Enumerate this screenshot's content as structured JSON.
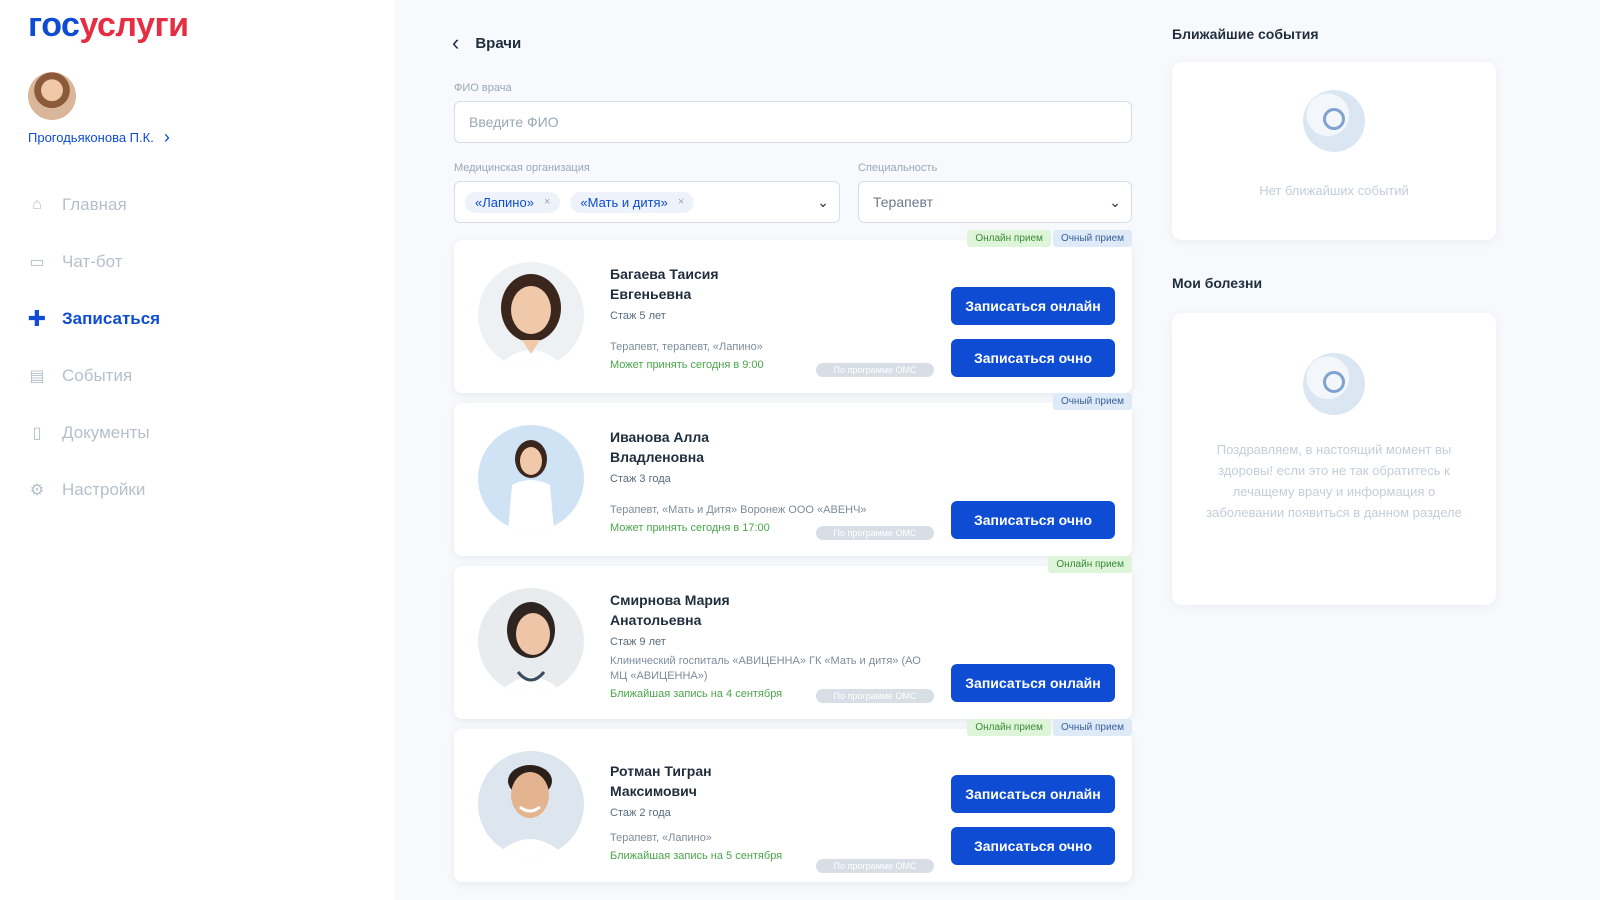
{
  "logo": {
    "part1": "гос",
    "part2": "услуги"
  },
  "user": {
    "name": "Прогодьяконова П.К."
  },
  "nav": [
    {
      "icon": "home-icon",
      "label": "Главная",
      "active": false
    },
    {
      "icon": "chat-icon",
      "label": "Чат-бот",
      "active": false
    },
    {
      "icon": "plus-icon",
      "label": "Записаться",
      "active": true
    },
    {
      "icon": "calendar-icon",
      "label": "События",
      "active": false
    },
    {
      "icon": "document-icon",
      "label": "Документы",
      "active": false
    },
    {
      "icon": "gear-icon",
      "label": "Настройки",
      "active": false
    }
  ],
  "page": {
    "back_title": "Врачи"
  },
  "filters": {
    "fio_label": "ФИО врача",
    "fio_placeholder": "Введите ФИО",
    "org_label": "Медицинская организация",
    "org_chips": [
      "«Лапино»",
      "«Мать и дитя»"
    ],
    "spec_label": "Специальность",
    "spec_value": "Терапевт"
  },
  "doctors": [
    {
      "name_line1": "Багаева Таисия",
      "name_line2": "Евгеньевна",
      "experience": "Стаж 5 лет",
      "specialty": "Терапевт, терапевт, «Лапино»",
      "availability": "Может принять сегодня в 9:00",
      "pill": "По программе ОМС",
      "tags": [
        "Онлайн прием",
        "Очный прием"
      ],
      "buttons": [
        "Записаться онлайн",
        "Записаться очно"
      ]
    },
    {
      "name_line1": "Иванова Алла",
      "name_line2": "Владленовна",
      "experience": "Стаж 3 года",
      "specialty": "Терапевт, «Мать и Дитя» Воронеж ООО «АВЕНЧ»",
      "availability": "Может принять сегодня в 17:00",
      "pill": "По программе ОМС",
      "tags": [
        "Очный прием"
      ],
      "buttons": [
        "Записаться очно"
      ]
    },
    {
      "name_line1": "Смирнова Мария",
      "name_line2": "Анатольевна",
      "experience": "Стаж 9 лет",
      "specialty": "Клинический госпиталь «АВИЦЕННА» ГК «Мать и дитя» (АО МЦ «АВИЦЕННА»)",
      "availability": "Ближайшая запись на 4 сентября",
      "pill": "По программе ОМС",
      "tags": [
        "Онлайн прием"
      ],
      "buttons": [
        "Записаться онлайн"
      ]
    },
    {
      "name_line1": "Ротман Тигран",
      "name_line2": "Максимович",
      "experience": "Стаж 2 года",
      "specialty": "Терапевт, «Лапино»",
      "availability": "Ближайшая запись на 5 сентября",
      "pill": "По программе ОМС",
      "tags": [
        "Онлайн прием",
        "Очный прием"
      ],
      "buttons": [
        "Записаться онлайн",
        "Записаться очно"
      ]
    }
  ],
  "right": {
    "events_title": "Ближайшие события",
    "events_empty": "Нет ближайших событий",
    "diseases_title": "Мои болезни",
    "diseases_empty": "Поздравляем, в настоящий момент вы здоровы! если это не так обратитесь к лечащему врачу и информация о заболевании появиться в данном разделе"
  },
  "colors": {
    "brand_blue": "#0d4cd3",
    "brand_red": "#e52e44",
    "online_tag": "#dff5da",
    "offline_tag": "#dfeaf8"
  }
}
